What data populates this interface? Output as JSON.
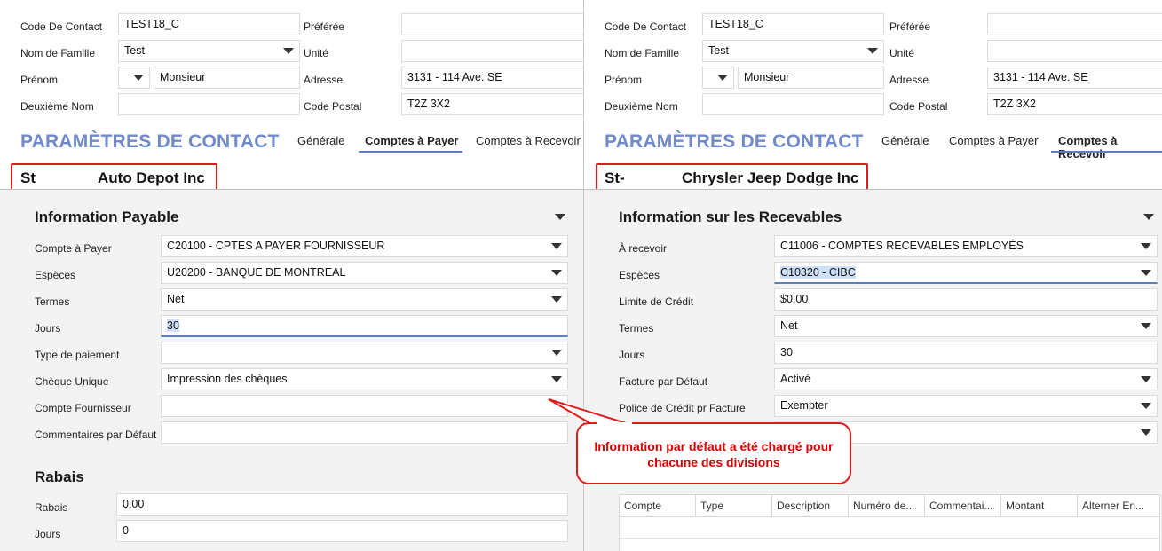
{
  "left": {
    "header": {
      "code_label": "Code De Contact",
      "code_value": "TEST18_C",
      "nom_label": "Nom de Famille",
      "nom_value": "Test",
      "prenom_label": "Prénom",
      "prenom_value": "Monsieur",
      "deuxieme_label": "Deuxième Nom",
      "deuxieme_value": "",
      "preferee_label": "Préférée",
      "preferee_value": "",
      "unite_label": "Unité",
      "unite_value": "",
      "adresse_label": "Adresse",
      "adresse_value": "3131 - 114 Ave. SE",
      "postal_label": "Code Postal",
      "postal_value": "T2Z 3X2"
    },
    "title": "PARAMÈTRES DE CONTACT",
    "tabs": [
      "Générale",
      "Comptes à Payer",
      "Comptes à Recevoir"
    ],
    "active_tab": "Comptes à Payer",
    "division": {
      "code": "St",
      "name": "Auto Depot Inc"
    },
    "section1": {
      "title": "Information Payable",
      "fields": [
        {
          "label": "Compte à Payer",
          "value": "C20100 - CPTES A PAYER FOURNISSEUR",
          "dropdown": true
        },
        {
          "label": "Espèces",
          "value": "U20200 - BANQUE DE MONTREAL",
          "dropdown": true
        },
        {
          "label": "Termes",
          "value": "Net",
          "dropdown": true
        },
        {
          "label": "Jours",
          "value": "30",
          "dropdown": false
        },
        {
          "label": "Type de paiement",
          "value": "",
          "dropdown": true
        },
        {
          "label": "Chèque Unique",
          "value": "Impression des chèques",
          "dropdown": true
        },
        {
          "label": "Compte Fournisseur",
          "value": "",
          "dropdown": false
        },
        {
          "label": "Commentaires par Défaut",
          "value": "",
          "dropdown": false
        }
      ]
    },
    "section2": {
      "title": "Rabais",
      "fields": [
        {
          "label": "Rabais",
          "value": "0.00"
        },
        {
          "label": "Jours",
          "value": "0"
        }
      ]
    }
  },
  "right": {
    "header": {
      "code_label": "Code De Contact",
      "code_value": "TEST18_C",
      "nom_label": "Nom de Famille",
      "nom_value": "Test",
      "prenom_label": "Prénom",
      "prenom_value": "Monsieur",
      "deuxieme_label": "Deuxième Nom",
      "deuxieme_value": "",
      "preferee_label": "Préférée",
      "preferee_value": "",
      "unite_label": "Unité",
      "unite_value": "",
      "adresse_label": "Adresse",
      "adresse_value": "3131 - 114 Ave. SE",
      "postal_label": "Code Postal",
      "postal_value": "T2Z 3X2"
    },
    "title": "PARAMÈTRES DE CONTACT",
    "tabs": [
      "Générale",
      "Comptes à Payer",
      "Comptes à Recevoir"
    ],
    "active_tab": "Comptes à Recevoir",
    "division": {
      "code": "St-",
      "name": "Chrysler Jeep Dodge Inc"
    },
    "section1": {
      "title": "Information sur les Recevables",
      "fields": [
        {
          "label": "À recevoir",
          "value": "C11006 - COMPTES RECEVABLES EMPLOYÉS",
          "dropdown": true
        },
        {
          "label": "Espèces",
          "value": "C10320 - CIBC",
          "dropdown": true
        },
        {
          "label": "Limite de Crédit",
          "value": "$0.00",
          "dropdown": false
        },
        {
          "label": "Termes",
          "value": "Net",
          "dropdown": true
        },
        {
          "label": "Jours",
          "value": "30",
          "dropdown": false
        },
        {
          "label": "Facture par Défaut",
          "value": "Activé",
          "dropdown": true
        },
        {
          "label": "Police de Crédit pr Facture",
          "value": "Exempter",
          "dropdown": true
        },
        {
          "label": "",
          "value": "",
          "dropdown": true
        }
      ]
    },
    "grid_columns": [
      "Compte",
      "Type",
      "Description",
      "Numéro de...",
      "Commentai...",
      "Montant",
      "Alterner En..."
    ]
  },
  "callout": {
    "text": "Information par défaut a été chargé pour chacune des divisions"
  },
  "colors": {
    "accent": "#5b7fbf",
    "title": "#6f89c9",
    "highlight": "#e01b1b"
  }
}
